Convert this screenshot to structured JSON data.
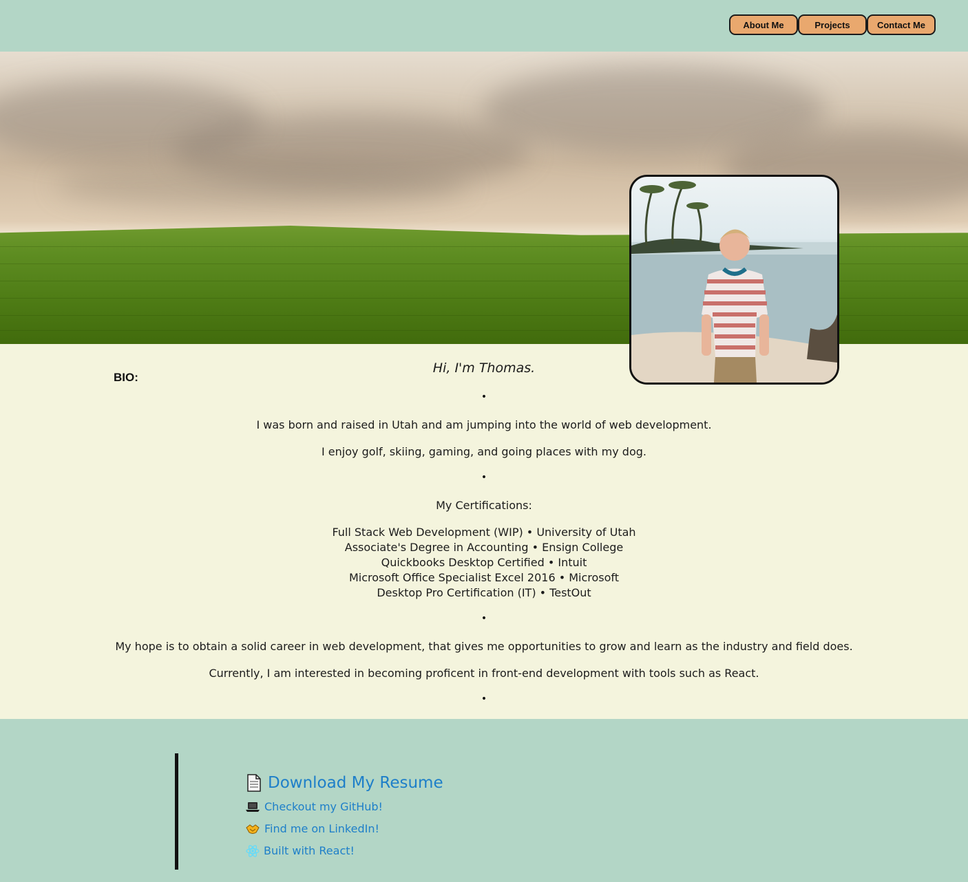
{
  "nav": {
    "items": [
      {
        "label": "About Me"
      },
      {
        "label": "Projects"
      },
      {
        "label": "Contact Me"
      }
    ]
  },
  "bio": {
    "label": "BIO:",
    "greeting": "Hi, I'm Thomas.",
    "separator": "•",
    "intro": [
      "I was born and raised in Utah and am jumping into the world of web development.",
      "I enjoy golf, skiing, gaming, and going places with my dog."
    ],
    "certifications_heading": "My Certifications:",
    "certifications": [
      "Full Stack Web Development (WIP) • University of Utah",
      "Associate's Degree in Accounting • Ensign College",
      "Quickbooks Desktop Certified • Intuit",
      "Microsoft Office Specialist Excel 2016 • Microsoft",
      "Desktop Pro Certification (IT) • TestOut"
    ],
    "goals": [
      "My hope is to obtain a solid career in web development, that gives me opportunities to grow and learn as the industry and field does.",
      "Currently, I am interested in becoming proficent in front-end development with tools such as React."
    ]
  },
  "footer": {
    "links": [
      {
        "icon": "document-icon",
        "label": "Download My Resume"
      },
      {
        "icon": "laptop-icon",
        "label": "Checkout my GitHub!"
      },
      {
        "icon": "handshake-icon",
        "label": "Find me on LinkedIn!"
      },
      {
        "icon": "react-icon",
        "label": "Built with React!"
      }
    ]
  },
  "colors": {
    "header_bg": "#b3d6c6",
    "bio_bg": "#f4f4dd",
    "nav_button": "#e9a86e",
    "link": "#1e7fc9"
  }
}
